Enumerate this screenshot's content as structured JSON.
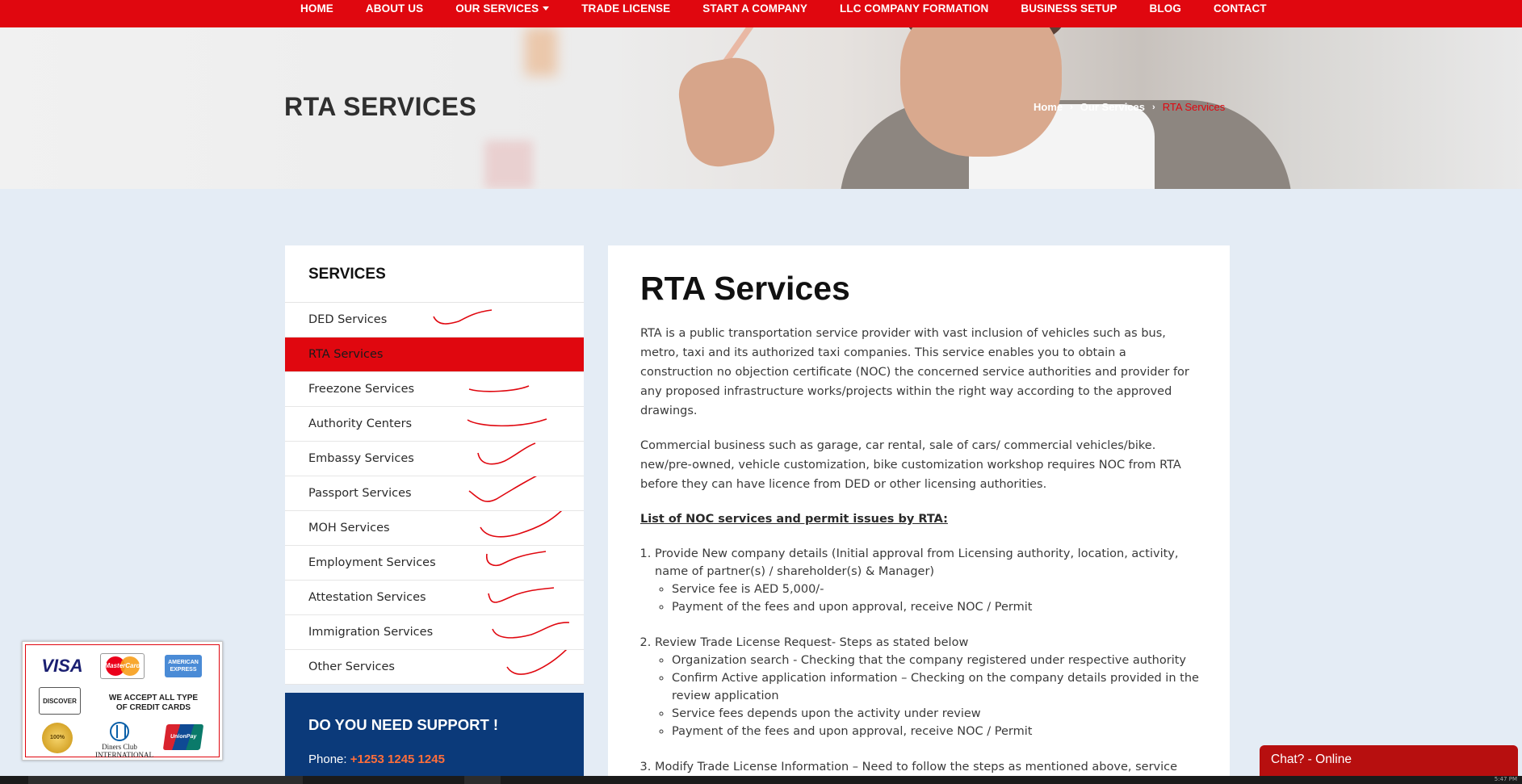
{
  "nav": {
    "items": [
      "HOME",
      "ABOUT US",
      "OUR SERVICES",
      "TRADE LICENSE",
      "START A COMPANY",
      "LLC COMPANY FORMATION",
      "BUSINESS SETUP",
      "BLOG",
      "CONTACT"
    ]
  },
  "hero": {
    "title": "RTA SERVICES",
    "breadcrumb": [
      "Home",
      "Our Services",
      "RTA Services"
    ]
  },
  "sidebar": {
    "heading": "SERVICES",
    "items": [
      "DED Services",
      "RTA Services",
      "Freezone Services",
      "Authority Centers",
      "Embassy Services",
      "Passport Services",
      "MOH Services",
      "Employment Services",
      "Attestation Services",
      "Immigration Services",
      "Other Services"
    ],
    "active_index": 1
  },
  "support": {
    "title": "DO YOU NEED SUPPORT !",
    "phone_label": "Phone: ",
    "phone": "+1253 1245 1245"
  },
  "main": {
    "title": "RTA Services",
    "paragraph1": "RTA is a public transportation service provider with vast inclusion of vehicles such as bus, metro, taxi and its authorized taxi companies. This service enables you to obtain a construction no objection certificate (NOC) the concerned service authorities and provider for any proposed infrastructure works/projects within the right way according to the approved drawings.",
    "paragraph2": "Commercial business such as garage, car rental, sale of cars/ commercial vehicles/bike. new/pre-owned, vehicle customization, bike customization workshop requires NOC from RTA before they can have licence from DED or other licensing authorities.",
    "list_heading": "List of NOC services and permit issues by RTA:",
    "steps": [
      {
        "text": "Provide New company details (Initial approval from Licensing authority, location, activity, name of partner(s) / shareholder(s) & Manager)",
        "bullets": [
          "Service fee is AED 5,000/-",
          "Payment of the fees and upon approval, receive NOC / Permit"
        ]
      },
      {
        "text": "Review Trade License Request- Steps as stated below",
        "bullets": [
          "Organization search - Checking that the company registered under respective authority",
          "Confirm Active application information – Checking on the company details provided in the review application",
          "Service fees depends upon the activity under review",
          "Payment of the fees and upon approval, receive NOC / Permit"
        ]
      },
      {
        "text": "Modify Trade License Information – Need to follow the steps as mentioned above, service fee depends upon the nature of Modification of Trade license information.",
        "bullets": []
      }
    ]
  },
  "payment": {
    "visa": "VISA",
    "mastercard": "MasterCard",
    "amex": "AMERICAN EXPRESS",
    "discover": "DISCOVER",
    "accept_text": "WE ACCEPT ALL TYPE OF CREDIT CARDS",
    "seal": "100%",
    "diners": "Diners Club INTERNATIONAL",
    "unionpay": "UnionPay"
  },
  "chat": {
    "label": "Chat? - Online"
  },
  "taskbar": {
    "clock": "5:47 PM"
  },
  "colors": {
    "brand_red": "#e0070f",
    "support_blue": "#0b3a7a",
    "phone_orange": "#ff6e3a",
    "chat_red": "#b70f0f",
    "page_bg": "#e4ecf5"
  }
}
